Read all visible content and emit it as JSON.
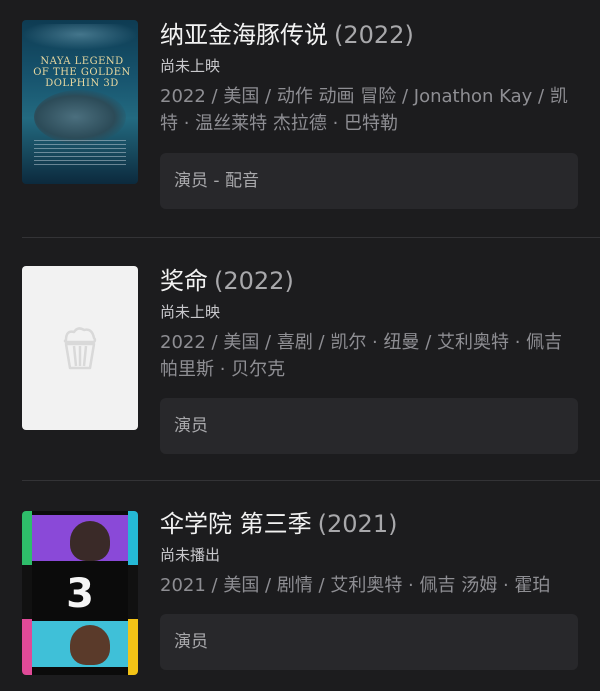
{
  "items": [
    {
      "title": "纳亚金海豚传说",
      "year": "(2022)",
      "status": "尚未上映",
      "meta": "2022 / 美国 / 动作 动画 冒险 / Jonathon Kay / 凯特 · 温丝莱特 杰拉德 · 巴特勒",
      "role": "演员 - 配音",
      "poster_text": "NAYA LEGEND OF THE GOLDEN DOLPHIN 3D"
    },
    {
      "title": "奖命",
      "year": "(2022)",
      "status": "尚未上映",
      "meta": "2022 / 美国 / 喜剧 / 凯尔 · 纽曼 / 艾利奥特 · 佩吉 帕里斯 · 贝尔克",
      "role": "演员",
      "poster_icon": "popcorn-icon"
    },
    {
      "title": "伞学院 第三季",
      "year": "(2021)",
      "status": "尚未播出",
      "meta": "2021 / 美国 / 剧情 / 艾利奥特 · 佩吉 汤姆 · 霍珀",
      "role": "演员",
      "poster_text": "3"
    }
  ]
}
